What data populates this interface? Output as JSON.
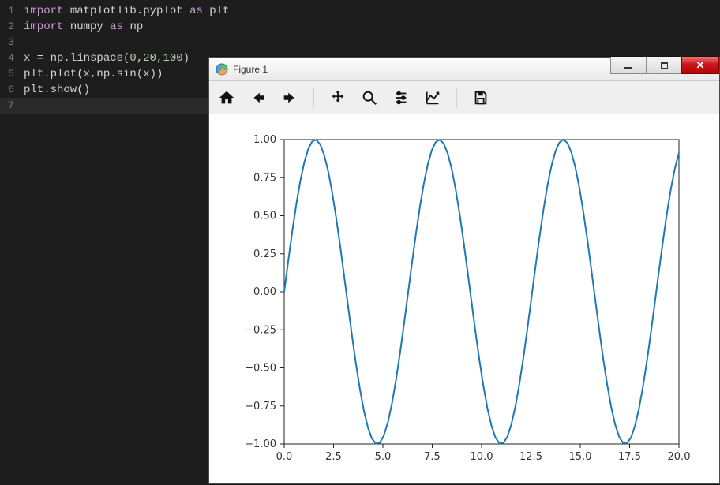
{
  "editor": {
    "lines": [
      {
        "n": 1,
        "tokens": [
          [
            "kw",
            "import"
          ],
          [
            "id",
            " matplotlib.pyplot "
          ],
          [
            "kw",
            "as"
          ],
          [
            "id",
            " plt"
          ]
        ]
      },
      {
        "n": 2,
        "tokens": [
          [
            "kw",
            "import"
          ],
          [
            "id",
            " numpy "
          ],
          [
            "kw",
            "as"
          ],
          [
            "id",
            " np"
          ]
        ]
      },
      {
        "n": 3,
        "tokens": [
          [
            "id",
            ""
          ]
        ]
      },
      {
        "n": 4,
        "tokens": [
          [
            "id",
            "x = np.linspace("
          ],
          [
            "num",
            "0"
          ],
          [
            "id",
            ","
          ],
          [
            "num",
            "20"
          ],
          [
            "id",
            ","
          ],
          [
            "num",
            "100"
          ],
          [
            "id",
            ")"
          ]
        ]
      },
      {
        "n": 5,
        "tokens": [
          [
            "id",
            "plt.plot(x,np.sin(x))"
          ]
        ]
      },
      {
        "n": 6,
        "tokens": [
          [
            "id",
            "plt.show()"
          ]
        ]
      },
      {
        "n": 7,
        "tokens": [
          [
            "id",
            ""
          ]
        ],
        "current": true
      }
    ]
  },
  "figure_window": {
    "title": "Figure 1",
    "toolbar": {
      "buttons": [
        "home",
        "back",
        "forward",
        "|",
        "pan",
        "zoom",
        "configure",
        "edit-axes",
        "|",
        "save"
      ]
    }
  },
  "chart_data": {
    "type": "line",
    "title": "",
    "xlabel": "",
    "ylabel": "",
    "xlim": [
      0,
      20
    ],
    "ylim": [
      -1.0,
      1.0
    ],
    "xticks": [
      0.0,
      2.5,
      5.0,
      7.5,
      10.0,
      12.5,
      15.0,
      17.5,
      20.0
    ],
    "yticks": [
      -1.0,
      -0.75,
      -0.5,
      -0.25,
      0.0,
      0.25,
      0.5,
      0.75,
      1.0
    ],
    "ytick_labels": [
      "−1.00",
      "−0.75",
      "−0.50",
      "−0.25",
      "0.00",
      "0.25",
      "0.50",
      "0.75",
      "1.00"
    ],
    "xtick_labels": [
      "0.0",
      "2.5",
      "5.0",
      "7.5",
      "10.0",
      "12.5",
      "15.0",
      "17.5",
      "20.0"
    ],
    "series": [
      {
        "name": "sin(x)",
        "color": "#1f77b4",
        "formula": "y = sin(x)",
        "x_sample": "numpy.linspace(0, 20, 100)",
        "values": "sin of each x"
      }
    ]
  },
  "colors": {
    "editor_bg": "#1d1d1d",
    "keyword": "#c99bd1",
    "number": "#b5cea8",
    "line_color": "#1f77b4",
    "close_btn": "#c8171e"
  }
}
